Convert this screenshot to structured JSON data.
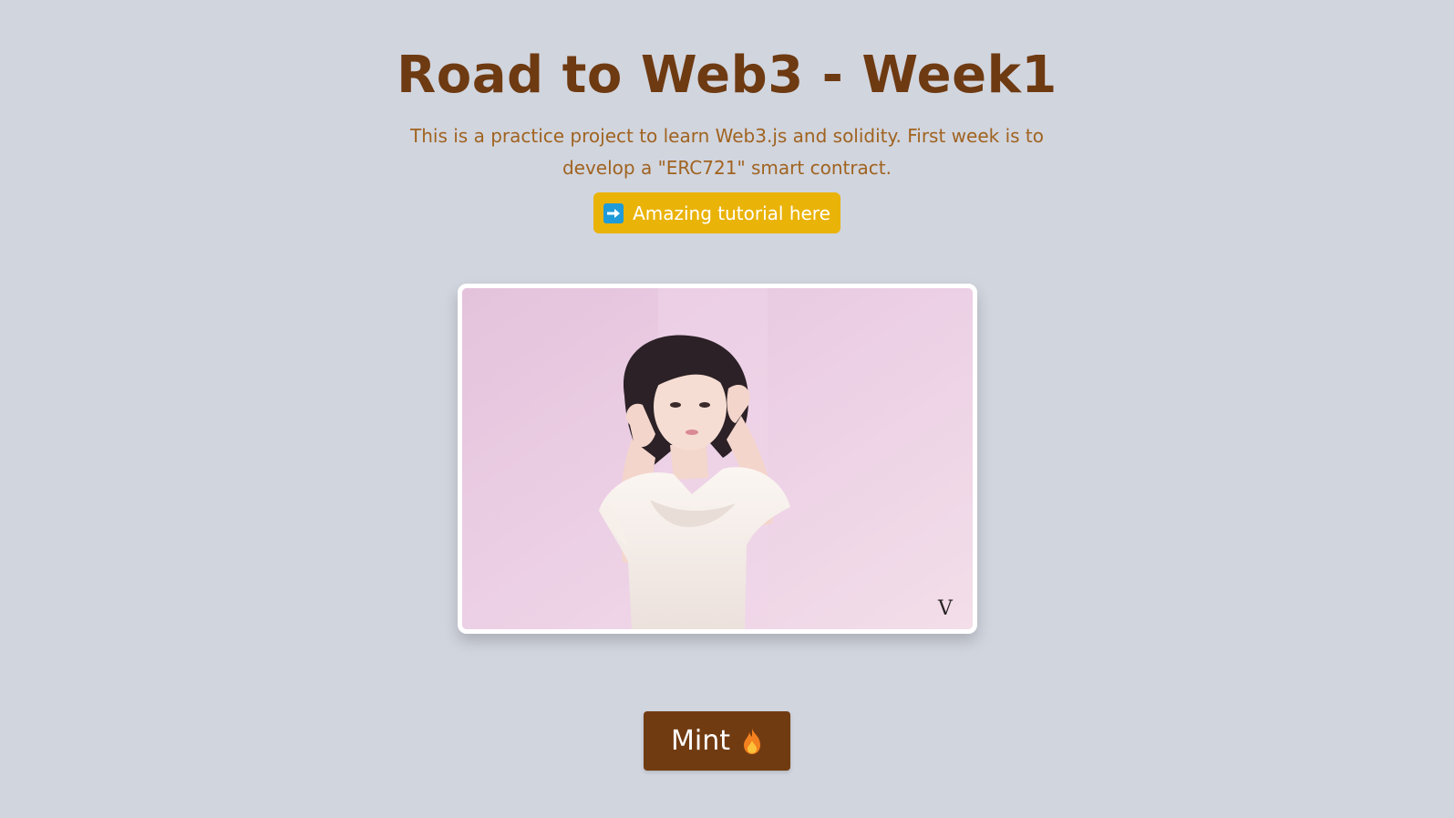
{
  "header": {
    "title": "Road to Web3 - Week1",
    "description": "This is a practice project to learn Web3.js and solidity. First week is to develop a \"ERC721\" smart contract."
  },
  "tutorial_link": {
    "label": "Amazing tutorial here",
    "icon": "right-arrow-icon"
  },
  "nft_image": {
    "watermark": "V"
  },
  "mint_button": {
    "label": "Mint",
    "icon": "fire-icon"
  },
  "colors": {
    "background": "#d1d5de",
    "title": "#6e3a12",
    "subtitle": "#a06320",
    "tutorial_button": "#eab308",
    "mint_button": "#713b11"
  }
}
